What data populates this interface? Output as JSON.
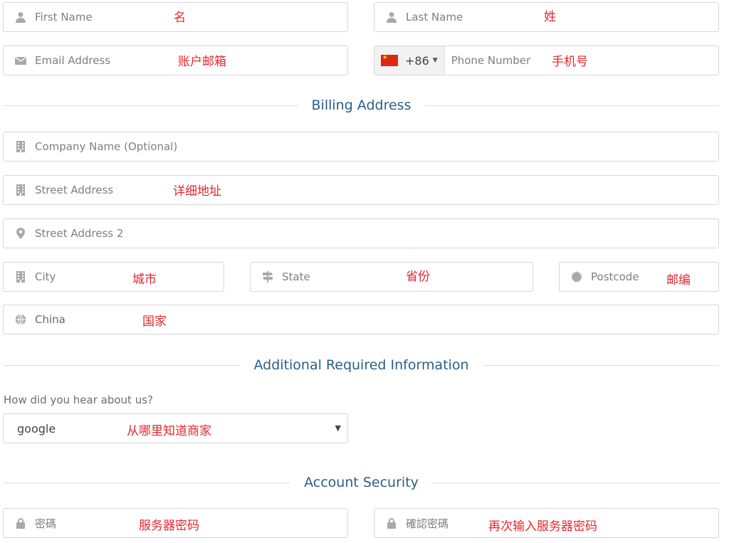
{
  "personal": {
    "first_name": {
      "placeholder": "First Name",
      "note": "名",
      "icon": "user-icon"
    },
    "last_name": {
      "placeholder": "Last Name",
      "note": "姓",
      "icon": "user-icon"
    },
    "email": {
      "placeholder": "Email Address",
      "note": "账户邮箱",
      "icon": "envelope-icon"
    },
    "phone": {
      "dial_code": "+86",
      "placeholder": "Phone Number",
      "note": "手机号",
      "country_flag": "china-flag-icon"
    }
  },
  "billing": {
    "title": "Billing Address",
    "company": {
      "placeholder": "Company Name (Optional)",
      "icon": "building-icon"
    },
    "street1": {
      "placeholder": "Street Address",
      "note": "详细地址",
      "icon": "building-icon"
    },
    "street2": {
      "placeholder": "Street Address 2",
      "icon": "map-marker-icon"
    },
    "city": {
      "placeholder": "City",
      "note": "城市",
      "icon": "building-icon"
    },
    "state": {
      "placeholder": "State",
      "note": "省份",
      "icon": "signpost-icon"
    },
    "postcode": {
      "placeholder": "Postcode",
      "note": "邮编",
      "icon": "certificate-icon"
    },
    "country": {
      "value": "China",
      "note": "国家",
      "icon": "globe-icon"
    }
  },
  "additional": {
    "title": "Additional Required Information",
    "question": "How did you hear about us?",
    "selected": "google",
    "note": "从哪里知道商家"
  },
  "security": {
    "title": "Account Security",
    "password": {
      "placeholder": "密碼",
      "note": "服务器密码",
      "icon": "lock-icon"
    },
    "confirm": {
      "placeholder": "確認密碼",
      "note": "再次输入服务器密码",
      "icon": "lock-icon"
    }
  },
  "colors": {
    "accent": "#2a5f86",
    "note_red": "#e8262f",
    "border": "#d7d7d7",
    "icon_grey": "#a9a9a9"
  }
}
